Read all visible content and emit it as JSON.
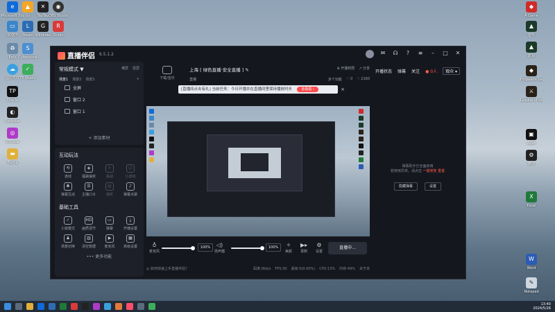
{
  "app": {
    "title": "直播伴侣",
    "version": "6.5.1.2"
  },
  "left_panel": {
    "mode_label": "常规模式 ▼",
    "mode_actions": [
      "横屏",
      "竖屏"
    ],
    "scene_tabs": [
      "场景1",
      "场景2",
      "场景3"
    ],
    "sources": [
      "全屏",
      "窗口 2",
      "窗口 1"
    ],
    "add_source": "+ 添加素材",
    "interactive_title": "互动玩法",
    "interactive_items": [
      "连线",
      "福袋抽奖",
      "挑战",
      "小游戏",
      "弹幕互动",
      "主播口令",
      "抽奖",
      "弹幕点歌"
    ],
    "basic_title": "基础工具",
    "basic_items": [
      "小窗模式",
      "画质调节",
      "弹幕",
      "开播设置",
      "场景切换",
      "清空数据",
      "麦克风",
      "高级设置"
    ],
    "more": "••• 更多功能"
  },
  "center": {
    "room_icon_label": "下载/音乐",
    "room_title": "上海 [ 绿色直播·安全直播 ] ✎",
    "room_sub": "直播",
    "room_r1": [
      "⊕ 开播权限",
      "↗ 分享"
    ],
    "room_r2": [
      "多个功能",
      "♡ 0",
      "♡ 2160"
    ],
    "banner_text": "[直播间点击有礼] 当前任务：今日开播并在直播间里保持播放时长",
    "banner_btn": "去看看 ›",
    "banner_close": "×",
    "mic_label": "麦克风",
    "mic_pct": "100%",
    "speaker_label": "扬声器",
    "speaker_pct": "100%",
    "tools": [
      "美颜",
      "录制",
      "设置"
    ],
    "live_btn": "直播中...",
    "status_tip": "◎ 如何快速上手直播伴侣？",
    "stats": [
      "码率:0kb/s",
      "FPS:30",
      "丢帧:0(0.00%)",
      "CPU:13%",
      "内存:49%",
      "关于本"
    ]
  },
  "right_panel": {
    "tabs": [
      "开播状态",
      "弹幕"
    ],
    "extra": "关注",
    "hot": "● 0人",
    "sel": "观众 ▾",
    "msg_line1": "弹幕助手已全面启用",
    "msg_line2": "若使用异常，请点击",
    "msg_link": "一键修复",
    "msg_link2": "重置",
    "btn_fix": "隐藏弹幕",
    "btn_set": "设置"
  },
  "taskbar": {
    "time": "13:40",
    "date": "2024/5/26"
  },
  "desktop_icons": [
    "Microsoft Edge",
    "Go",
    "TapTap",
    "OBS Studio",
    "QQ音乐",
    "Steam",
    "Windows",
    "Origin",
    "Epic",
    "Cyberpunk",
    "图层文件",
    "TP Studio",
    "Oracle",
    "Rockstar",
    "VSCode",
    "Figma",
    "A Game",
    "音乐",
    "影视",
    "Hogwarts Legacy",
    "League of Legends",
    "Apex",
    "微信",
    "Excel",
    "Word",
    "Notepad"
  ],
  "colors": {
    "accent": "#ff4d4f",
    "panel": "#1d2029",
    "bg": "#15171e"
  }
}
